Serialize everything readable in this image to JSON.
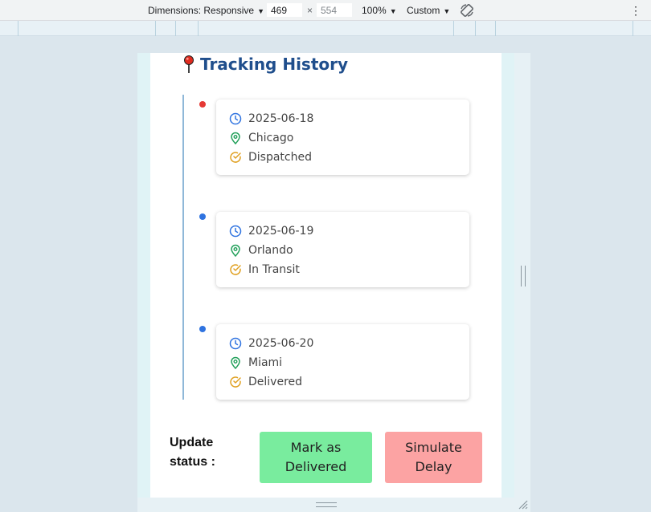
{
  "devtools": {
    "dimensions_label": "Dimensions: Responsive",
    "width_value": "469",
    "height_placeholder": "554",
    "times_sign": "×",
    "zoom": "100%",
    "throttle": "Custom"
  },
  "page": {
    "title": "Tracking History",
    "events": [
      {
        "date": "2025-06-18",
        "location": "Chicago",
        "status": "Dispatched",
        "dot_color": "#e53935"
      },
      {
        "date": "2025-06-19",
        "location": "Orlando",
        "status": "In Transit",
        "dot_color": "#2f73e0"
      },
      {
        "date": "2025-06-20",
        "location": "Miami",
        "status": "Delivered",
        "dot_color": "#2f73e0"
      }
    ],
    "update_label": "Update status :",
    "buttons": {
      "mark_delivered": "Mark as Delivered",
      "simulate_delay": "Simulate Delay"
    }
  },
  "colors": {
    "title": "#1f4e8c",
    "clock_icon": "#2f73e0",
    "location_icon": "#22a05a",
    "status_icon": "#e0a020",
    "deliver_button": "#79ec9e",
    "delay_button": "#fca3a3"
  }
}
